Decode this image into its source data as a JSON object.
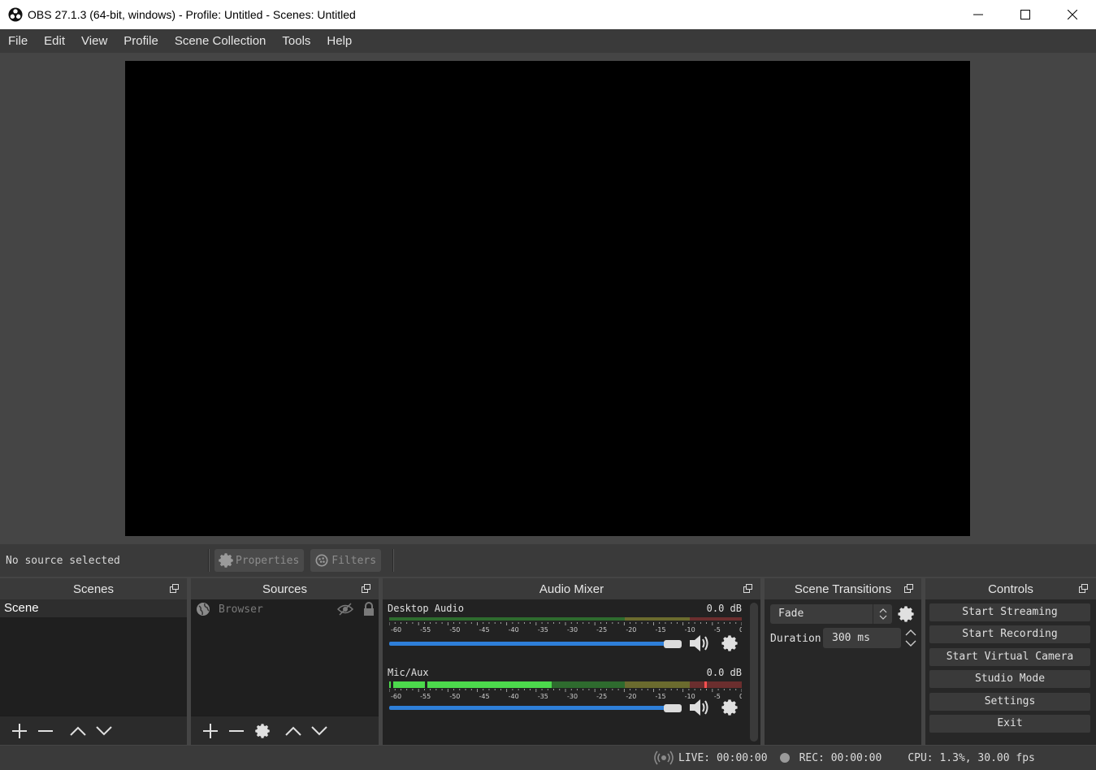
{
  "window": {
    "title": "OBS 27.1.3 (64-bit, windows) - Profile: Untitled - Scenes: Untitled"
  },
  "menu": {
    "items": [
      "File",
      "Edit",
      "View",
      "Profile",
      "Scene Collection",
      "Tools",
      "Help"
    ]
  },
  "source_toolbar": {
    "status": "No source selected",
    "properties_label": "Properties",
    "filters_label": "Filters"
  },
  "scenes": {
    "title": "Scenes",
    "items": [
      "Scene"
    ]
  },
  "sources": {
    "title": "Sources",
    "items": [
      "Browser"
    ]
  },
  "mixer": {
    "title": "Audio Mixer",
    "channels": [
      {
        "name": "Desktop Audio",
        "level": "0.0 dB",
        "volume_fraction": 1.0
      },
      {
        "name": "Mic/Aux",
        "level": "0.0 dB",
        "volume_fraction": 1.0
      }
    ],
    "scale_labels": [
      "-60",
      "-55",
      "-50",
      "-45",
      "-40",
      "-35",
      "-30",
      "-25",
      "-20",
      "-15",
      "-10",
      "-5",
      "0"
    ]
  },
  "transitions": {
    "title": "Scene Transitions",
    "selected": "Fade",
    "duration_label": "Duration",
    "duration_value": "300 ms"
  },
  "controls": {
    "title": "Controls",
    "buttons": [
      "Start Streaming",
      "Start Recording",
      "Start Virtual Camera",
      "Studio Mode",
      "Settings",
      "Exit"
    ]
  },
  "status": {
    "live": "LIVE: 00:00:00",
    "rec": "REC: 00:00:00",
    "cpu": "CPU: 1.3%, 30.00 fps"
  },
  "colors": {
    "accent_blue": "#2e7fd9",
    "meter_green": "#4cd94c",
    "meter_yellow": "#c8c84a",
    "meter_red": "#d94c4c"
  }
}
